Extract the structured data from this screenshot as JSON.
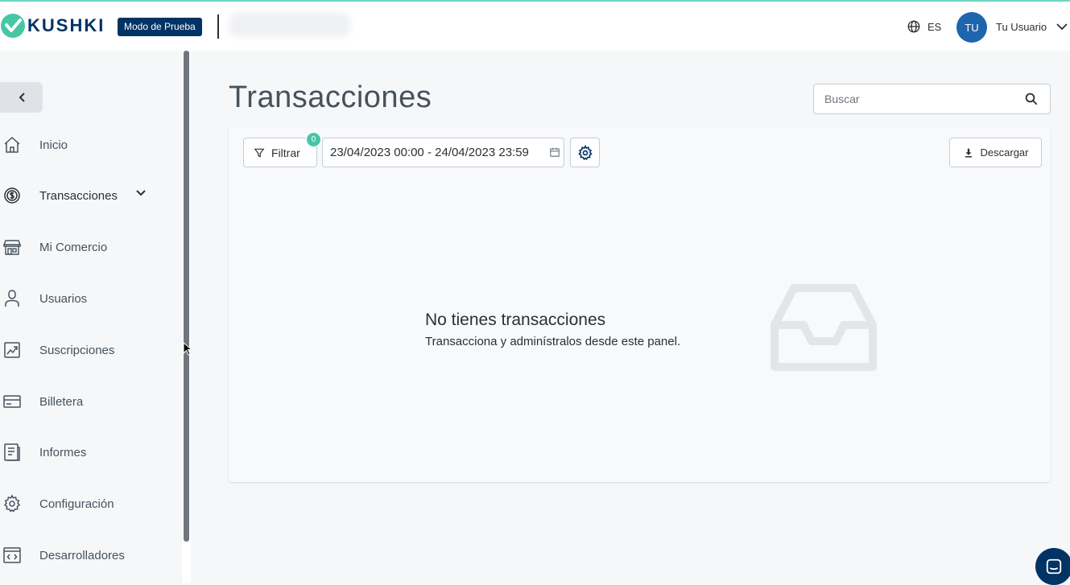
{
  "header": {
    "logo_text": "KUSHKI",
    "mode_badge": "Modo de Prueba",
    "language": "ES",
    "avatar_initials": "TU",
    "user_name": "Tu Usuario"
  },
  "sidebar": {
    "items": [
      {
        "label": "Inicio",
        "icon": "home-icon"
      },
      {
        "label": "Transacciones",
        "icon": "dollar-circle-icon"
      },
      {
        "label": "Mi Comercio",
        "icon": "store-icon"
      },
      {
        "label": "Usuarios",
        "icon": "user-icon"
      },
      {
        "label": "Suscripciones",
        "icon": "subscription-icon"
      },
      {
        "label": "Billetera",
        "icon": "wallet-icon"
      },
      {
        "label": "Informes",
        "icon": "report-icon"
      },
      {
        "label": "Configuración",
        "icon": "gear-icon"
      },
      {
        "label": "Desarrolladores",
        "icon": "code-icon"
      }
    ]
  },
  "main": {
    "title": "Transacciones",
    "search_placeholder": "Buscar",
    "toolbar": {
      "filter_label": "Filtrar",
      "filter_count": "0",
      "date_range": "23/04/2023 00:00 - 24/04/2023 23:59",
      "download_label": "Descargar"
    },
    "empty_state": {
      "title": "No tienes transacciones",
      "subtitle": "Transacciona y adminístralos desde este panel."
    }
  },
  "colors": {
    "brand": "#023365",
    "accent": "#47c6a5",
    "avatar": "#1e65ae"
  }
}
